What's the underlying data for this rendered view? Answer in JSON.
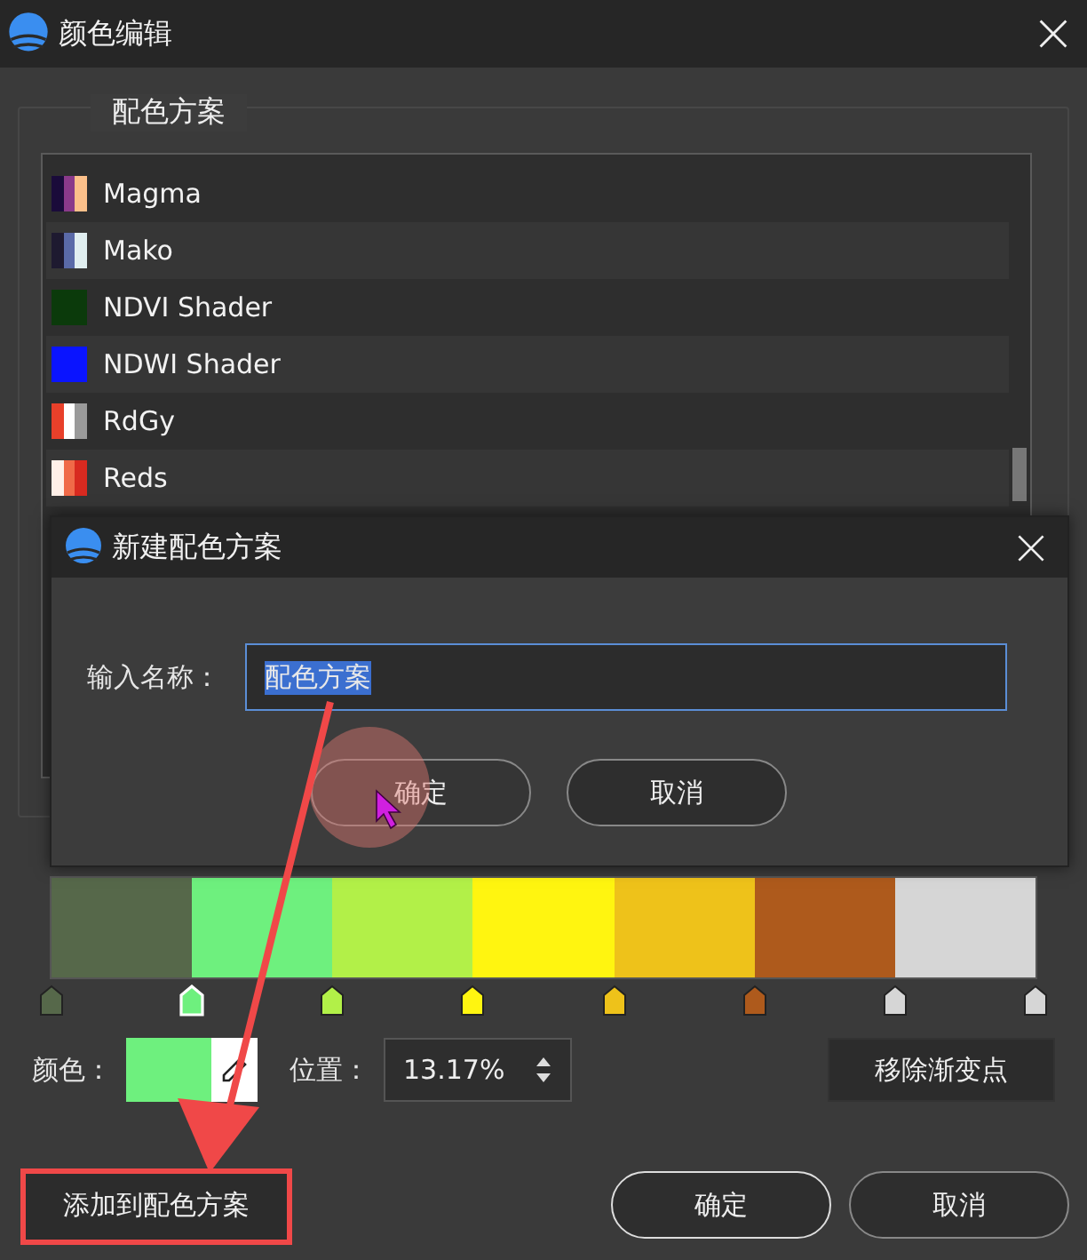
{
  "window": {
    "title": "颜色编辑"
  },
  "scheme_group": {
    "label": "配色方案"
  },
  "schemes": [
    {
      "name": "Magma",
      "stops": [
        {
          "color": "#1a0b3a"
        },
        {
          "color": "#8a3a8a"
        },
        {
          "color": "#fcc08a"
        }
      ]
    },
    {
      "name": "Mako",
      "stops": [
        {
          "color": "#1e1a30"
        },
        {
          "color": "#5a6aa8"
        },
        {
          "color": "#e0eef0"
        }
      ]
    },
    {
      "name": "NDVI Shader",
      "stops": [
        {
          "color": "#0b3a0b"
        }
      ]
    },
    {
      "name": "NDWI Shader",
      "stops": [
        {
          "color": "#0a14ff"
        }
      ]
    },
    {
      "name": "RdGy",
      "stops": [
        {
          "color": "#e8402a"
        },
        {
          "color": "#ffffff"
        },
        {
          "color": "#9a9a9a"
        }
      ]
    },
    {
      "name": "Reds",
      "stops": [
        {
          "color": "#fff0e8"
        },
        {
          "color": "#f06a48"
        },
        {
          "color": "#d82a20"
        }
      ]
    }
  ],
  "gradient_stops": [
    {
      "color": "#56684a",
      "selected": false
    },
    {
      "color": "#6ef07e",
      "selected": true
    },
    {
      "color": "#b2f048",
      "selected": false
    },
    {
      "color": "#fff510",
      "selected": false
    },
    {
      "color": "#eec21a",
      "selected": false
    },
    {
      "color": "#ae5a1c",
      "selected": false
    },
    {
      "color": "#d6d6d6",
      "selected": false
    },
    {
      "color": "#d6d6d6",
      "selected": false
    }
  ],
  "color_field": {
    "label": "颜色：",
    "color": "#6ef07e"
  },
  "position_field": {
    "label": "位置：",
    "value": "13.17%"
  },
  "remove_stop_button": "移除渐变点",
  "add_to_scheme_button": "添加到配色方案",
  "buttons": [
    "确定",
    "取消"
  ],
  "dialog": {
    "title": "新建配色方案",
    "label": "输入名称：",
    "value": "配色方案",
    "buttons": [
      "确定",
      "取消"
    ]
  }
}
